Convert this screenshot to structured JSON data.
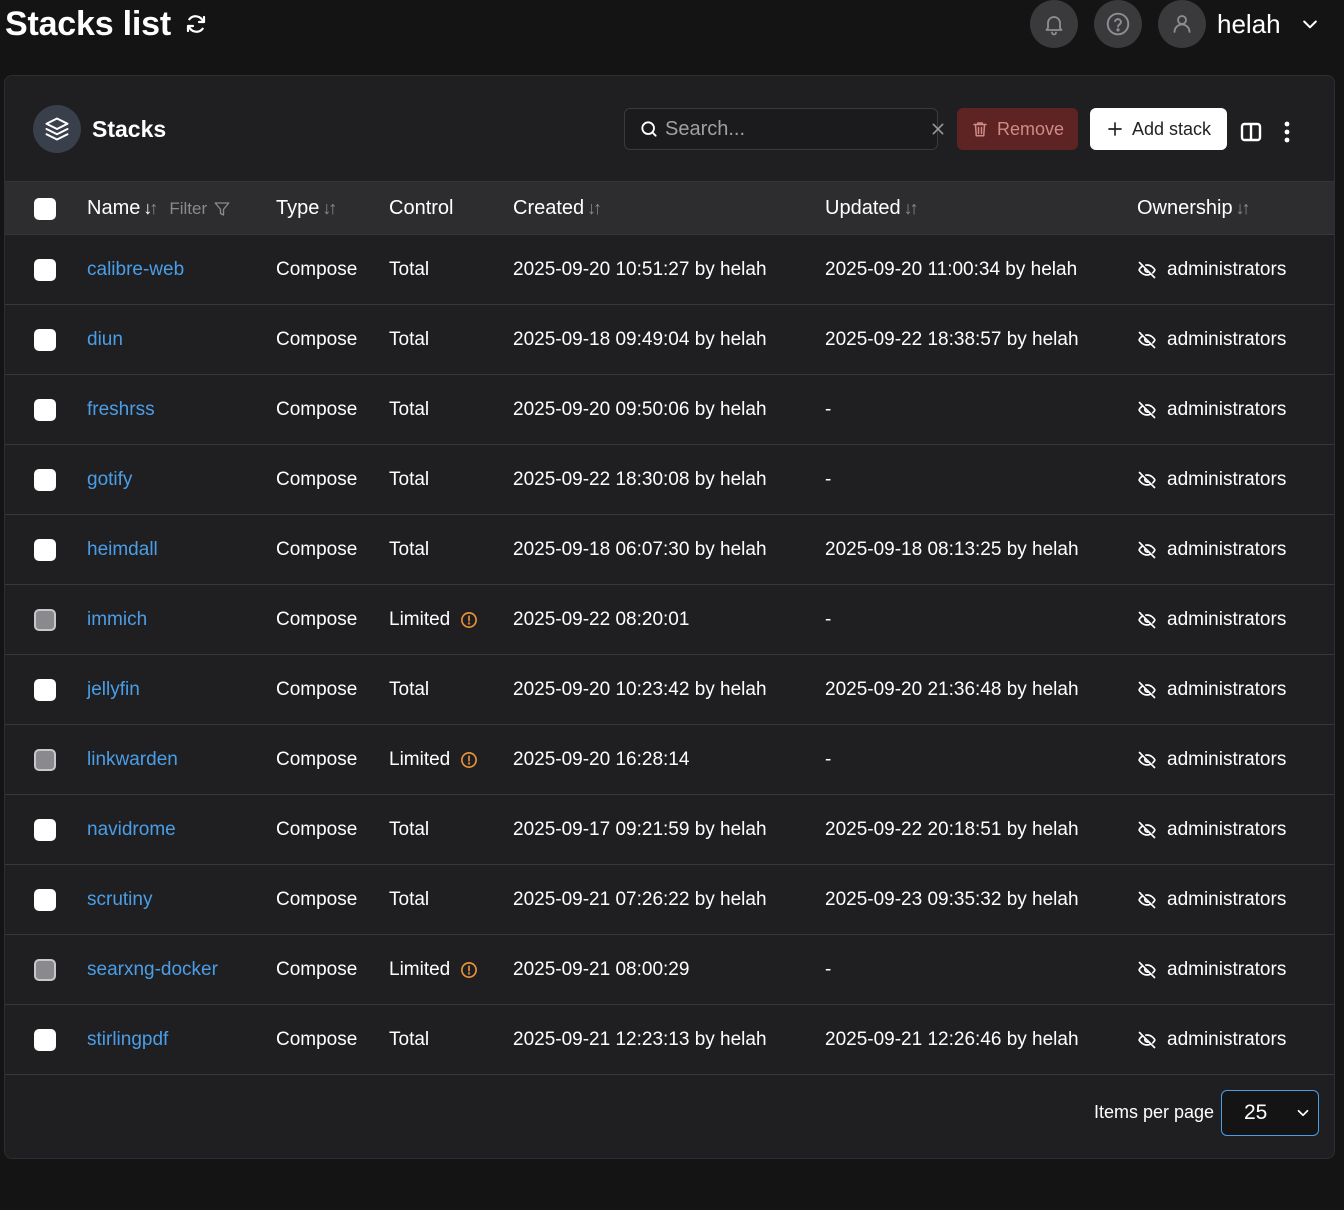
{
  "header": {
    "title": "Stacks list",
    "user": "helah"
  },
  "panel": {
    "title": "Stacks",
    "search_placeholder": "Search...",
    "remove_label": "Remove",
    "add_label": "Add stack"
  },
  "columns": {
    "name": "Name",
    "filter": "Filter",
    "type": "Type",
    "control": "Control",
    "created": "Created",
    "updated": "Updated",
    "ownership": "Ownership"
  },
  "rows": [
    {
      "name": "calibre-web",
      "type": "Compose",
      "control": "Total",
      "created": "2025-09-20 10:51:27 by helah",
      "updated": "2025-09-20 11:00:34 by helah",
      "ownership": "administrators",
      "limited": false
    },
    {
      "name": "diun",
      "type": "Compose",
      "control": "Total",
      "created": "2025-09-18 09:49:04 by helah",
      "updated": "2025-09-22 18:38:57 by helah",
      "ownership": "administrators",
      "limited": false
    },
    {
      "name": "freshrss",
      "type": "Compose",
      "control": "Total",
      "created": "2025-09-20 09:50:06 by helah",
      "updated": "-",
      "ownership": "administrators",
      "limited": false
    },
    {
      "name": "gotify",
      "type": "Compose",
      "control": "Total",
      "created": "2025-09-22 18:30:08 by helah",
      "updated": "-",
      "ownership": "administrators",
      "limited": false
    },
    {
      "name": "heimdall",
      "type": "Compose",
      "control": "Total",
      "created": "2025-09-18 06:07:30 by helah",
      "updated": "2025-09-18 08:13:25 by helah",
      "ownership": "administrators",
      "limited": false
    },
    {
      "name": "immich",
      "type": "Compose",
      "control": "Limited",
      "created": "2025-09-22 08:20:01",
      "updated": "-",
      "ownership": "administrators",
      "limited": true
    },
    {
      "name": "jellyfin",
      "type": "Compose",
      "control": "Total",
      "created": "2025-09-20 10:23:42 by helah",
      "updated": "2025-09-20 21:36:48 by helah",
      "ownership": "administrators",
      "limited": false
    },
    {
      "name": "linkwarden",
      "type": "Compose",
      "control": "Limited",
      "created": "2025-09-20 16:28:14",
      "updated": "-",
      "ownership": "administrators",
      "limited": true
    },
    {
      "name": "navidrome",
      "type": "Compose",
      "control": "Total",
      "created": "2025-09-17 09:21:59 by helah",
      "updated": "2025-09-22 20:18:51 by helah",
      "ownership": "administrators",
      "limited": false
    },
    {
      "name": "scrutiny",
      "type": "Compose",
      "control": "Total",
      "created": "2025-09-21 07:26:22 by helah",
      "updated": "2025-09-23 09:35:32 by helah",
      "ownership": "administrators",
      "limited": false
    },
    {
      "name": "searxng-docker",
      "type": "Compose",
      "control": "Limited",
      "created": "2025-09-21 08:00:29",
      "updated": "-",
      "ownership": "administrators",
      "limited": true
    },
    {
      "name": "stirlingpdf",
      "type": "Compose",
      "control": "Total",
      "created": "2025-09-21 12:23:13 by helah",
      "updated": "2025-09-21 12:26:46 by helah",
      "ownership": "administrators",
      "limited": false
    }
  ],
  "footer": {
    "items_per_page_label": "Items per page",
    "items_per_page_value": "25"
  },
  "icons": {
    "refresh": "refresh-icon",
    "bell": "bell-icon",
    "help": "help-icon",
    "user": "user-icon",
    "stacks": "layers-icon",
    "search": "search-icon",
    "trash": "trash-icon",
    "plus": "plus-icon",
    "columns": "columns-icon",
    "kebab": "kebab-icon",
    "eye_off": "eye-off-icon",
    "warning": "warning-icon"
  },
  "colors": {
    "link": "#4a9ee8",
    "warning": "#e8923a",
    "remove_bg": "#5e2423"
  }
}
